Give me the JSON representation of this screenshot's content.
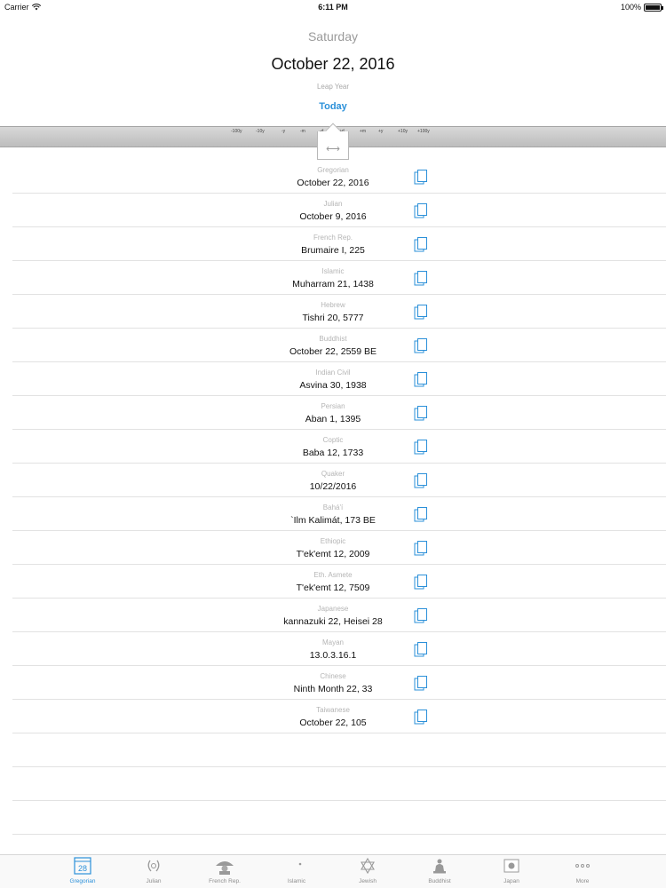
{
  "status_bar": {
    "carrier": "Carrier",
    "time": "6:11 PM",
    "battery": "100%",
    "battery_level": 1.0
  },
  "header": {
    "weekday": "Saturday",
    "date": "October 22, 2016",
    "leap_year": "Leap Year",
    "today_button": "Today"
  },
  "scrubber": {
    "labels": [
      "-100y",
      "-10y",
      "-y",
      "-m",
      "-d",
      "+d",
      "+m",
      "+y",
      "+10y",
      "+100y"
    ]
  },
  "calendars": [
    {
      "name": "Gregorian",
      "value": "October 22, 2016"
    },
    {
      "name": "Julian",
      "value": "October 9, 2016"
    },
    {
      "name": "French Rep.",
      "value": "Brumaire I, 225"
    },
    {
      "name": "Islamic",
      "value": "Muharram 21, 1438"
    },
    {
      "name": "Hebrew",
      "value": "Tishri 20, 5777"
    },
    {
      "name": "Buddhist",
      "value": "October 22, 2559 BE"
    },
    {
      "name": "Indian Civil",
      "value": "Asvina 30, 1938"
    },
    {
      "name": "Persian",
      "value": "Aban 1, 1395"
    },
    {
      "name": "Coptic",
      "value": "Baba 12, 1733"
    },
    {
      "name": "Quaker",
      "value": "10/22/2016"
    },
    {
      "name": "Bahá'í",
      "value": "`Ilm Kalimát, 173 BE"
    },
    {
      "name": "Ethiopic",
      "value": "T'ek'emt 12, 2009"
    },
    {
      "name": "Eth. Asmete",
      "value": "T'ek'emt 12, 7509"
    },
    {
      "name": "Japanese",
      "value": "kannazuki 22, Heisei 28"
    },
    {
      "name": "Mayan",
      "value": "13.0.3.16.1"
    },
    {
      "name": "Chinese",
      "value": "Ninth Month 22, 33"
    },
    {
      "name": "Taiwanese",
      "value": "October 22, 105"
    }
  ],
  "tabbar": {
    "active_index": 0,
    "tabs": [
      {
        "label": "Gregorian",
        "icon": "calendar-28-icon",
        "icon_text": "28"
      },
      {
        "label": "Julian",
        "icon": "laurel-wreath-icon"
      },
      {
        "label": "French Rep.",
        "icon": "napoleon-icon"
      },
      {
        "label": "Islamic",
        "icon": "crescent-star-icon"
      },
      {
        "label": "Jewish",
        "icon": "star-of-david-icon"
      },
      {
        "label": "Buddhist",
        "icon": "buddha-icon"
      },
      {
        "label": "Japan",
        "icon": "japan-flag-icon"
      },
      {
        "label": "More",
        "icon": "more-dots-icon"
      }
    ]
  },
  "colors": {
    "accent": "#2b90d9",
    "label_gray": "#b5b5b5",
    "scrubber_bg": "#c8c8c8"
  }
}
